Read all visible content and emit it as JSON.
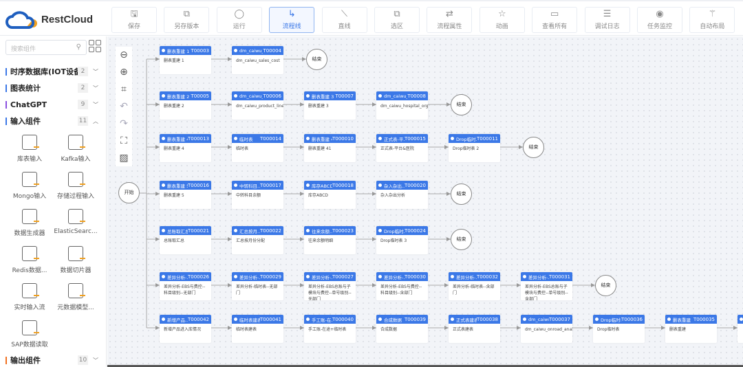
{
  "app": {
    "logo_text": "RestCloud",
    "brand_blue": "#1f5fbf",
    "brand_orange": "#f0a020",
    "accent": "#3b78e7"
  },
  "toolbar": [
    {
      "label": "保存",
      "icon": "save-icon",
      "glyph": "🖫"
    },
    {
      "label": "另存版本",
      "icon": "save-version-icon",
      "glyph": "⧉"
    },
    {
      "label": "运行",
      "icon": "run-circle-icon",
      "glyph": "◯"
    },
    {
      "label": "流程线",
      "icon": "flow-line-icon",
      "glyph": "↳",
      "active": true
    },
    {
      "label": "直线",
      "icon": "straight-line-icon",
      "glyph": "⟍"
    },
    {
      "label": "选区",
      "icon": "selection-icon",
      "glyph": "⧉"
    },
    {
      "label": "流程属性",
      "icon": "flow-properties-icon",
      "glyph": "⇄"
    },
    {
      "label": "动画",
      "icon": "animation-star-icon",
      "glyph": "☆"
    },
    {
      "label": "查看所有",
      "icon": "view-all-icon",
      "glyph": "▭"
    },
    {
      "label": "调试日志",
      "icon": "debug-log-icon",
      "glyph": "☰"
    },
    {
      "label": "任务监控",
      "icon": "task-monitor-icon",
      "glyph": "◉"
    },
    {
      "label": "自动布局",
      "icon": "auto-layout-wand-icon",
      "glyph": "⚚"
    }
  ],
  "sidebar": {
    "search_placeholder": "搜索组件",
    "categories": [
      {
        "label": "时序数据库(IOT设备)",
        "count": "2",
        "expanded": false
      },
      {
        "label": "图表统计",
        "count": "2",
        "expanded": false
      },
      {
        "label": "ChatGPT",
        "count": "9",
        "expanded": false
      },
      {
        "label": "输入组件",
        "count": "11",
        "expanded": true
      },
      {
        "label": "输出组件",
        "count": "10",
        "expanded": false
      }
    ],
    "components": [
      "库表输入",
      "Kafka输入",
      "Mongo输入",
      "存储过程输入",
      "数据生成器",
      "ElasticSearc...",
      "Redis数据...",
      "数据切片器",
      "实时输入流",
      "元数据模型...",
      "SAP数据读取"
    ]
  },
  "canvas": {
    "start_label": "开始",
    "end_label": "结束",
    "zoom_tools": [
      "zoom-out-icon",
      "zoom-in-icon",
      "fit-icon",
      "undo-icon",
      "redo-icon",
      "fullscreen-icon",
      "grid-hatch-icon"
    ],
    "rows": [
      {
        "nodes": [
          [
            "删表重建 1",
            "T00003",
            "删表重建 1"
          ],
          [
            "dm_caiwu_...",
            "T00004",
            "dm_caiwu_sales_cost"
          ]
        ],
        "end": true
      },
      {
        "nodes": [
          [
            "删表重建 2",
            "T00005",
            "删表重建 2"
          ],
          [
            "dm_caiwu_...",
            "T00006",
            "dm_caiwu_product_line"
          ],
          [
            "删表重建 3",
            "T00007",
            "删表重建 3"
          ],
          [
            "dm_caiwu_...",
            "T00008",
            "dm_caiwu_hospital_org_ship"
          ]
        ],
        "end": true
      },
      {
        "nodes": [
          [
            "删表重建 4",
            "T000013",
            "删表重建 4"
          ],
          [
            "临时表",
            "T000014",
            "临时表"
          ],
          [
            "删表重建 41",
            "T000010",
            "删表重建 41"
          ],
          [
            "正式表-平...",
            "T000015",
            "正式表-平台&医院"
          ],
          [
            "Drop临时...",
            "T000011",
            "Drop临时表 2"
          ]
        ],
        "end": true
      },
      {
        "nodes": [
          [
            "删表重建 5",
            "T000016",
            "删表重建 5"
          ],
          [
            "中转科目...",
            "T000017",
            "中转科目余额"
          ],
          [
            "库存ABCD",
            "T000018",
            "库存ABCD"
          ],
          [
            "杂入杂出...",
            "T000020",
            "杂入杂出分析"
          ]
        ],
        "end": true
      },
      {
        "nodes": [
          [
            "总账取汇总",
            "T000021",
            "总账取汇总"
          ],
          [
            "汇总按月...",
            "T000022",
            "汇总按月份分配"
          ],
          [
            "往来余额...",
            "T000023",
            "往来余额明细"
          ],
          [
            "Drop临时...",
            "T000024",
            "Drop临时表 3"
          ]
        ],
        "end": true
      },
      {
        "nodes": [
          [
            "差异分析-...",
            "T000026",
            "差异分析-EBS与费控--科目级别--无部门"
          ],
          [
            "差异分析-...",
            "T000029",
            "差异分析-临时表--无部门"
          ],
          [
            "差异分析-...",
            "T000027",
            "差异分析-EBS总账与子模块与费控--单号级别--无部门"
          ],
          [
            "差异分析-...",
            "T000030",
            "差异分析-EBS与费控--科目级别--含部门"
          ],
          [
            "差异分析-...",
            "T000032",
            "差异分析-临时表--含部门"
          ],
          [
            "差异分析-...",
            "T000031",
            "差异分析-EBS总账与子模块与费控--单号级别--含部门"
          ]
        ],
        "end": true
      },
      {
        "nodes": [
          [
            "新增产品...",
            "T000042",
            "新增产品进入库情况"
          ],
          [
            "临时表建表",
            "T000041",
            "临时表建表"
          ],
          [
            "手工账-在...",
            "T000040",
            "手工账-在途+临时表"
          ],
          [
            "合成数据",
            "T000039",
            "合成数据"
          ],
          [
            "正式表建表",
            "T000038",
            "正式表建表"
          ],
          [
            "dm_caiwu_...",
            "T000037",
            "dm_caiwu_onroad_analysis"
          ],
          [
            "Drop临时表",
            "T000036",
            "Drop临时表"
          ],
          [
            "删表重建",
            "T000035",
            "删表重建"
          ],
          [
            "",
            "",
            ""
          ]
        ],
        "end": false
      }
    ]
  }
}
